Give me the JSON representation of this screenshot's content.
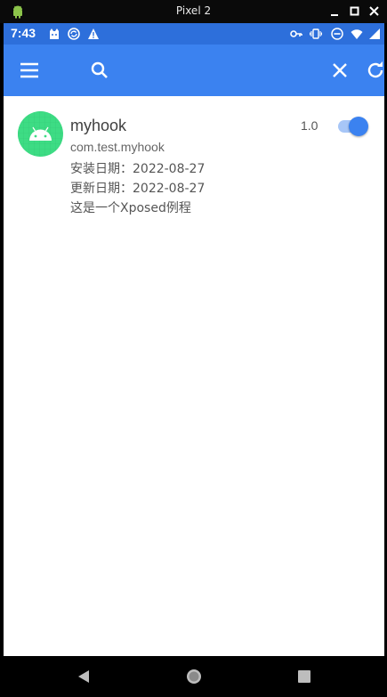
{
  "window": {
    "title": "Pixel 2",
    "icons": [
      "android-emulator-icon",
      "minimize-icon",
      "maximize-icon",
      "close-icon"
    ]
  },
  "statusbar": {
    "time": "7:43",
    "left_icons": [
      "cat-icon",
      "sync-icon",
      "warning-icon"
    ],
    "right_icons": [
      "key-icon",
      "vibrate-icon",
      "do-not-disturb-icon",
      "wifi-icon",
      "signal-icon"
    ]
  },
  "appbar": {
    "icons": [
      "menu-icon",
      "search-icon",
      "clear-icon",
      "refresh-icon"
    ],
    "color": "#3b82f0"
  },
  "modules": [
    {
      "name": "myhook",
      "package": "com.test.myhook",
      "install_date": "安装日期：2022-08-27",
      "update_date": "更新日期：2022-08-27",
      "description": "这是一个Xposed例程",
      "version": "1.0",
      "enabled": true
    }
  ],
  "navbar": {
    "icons": [
      "back-icon",
      "home-icon",
      "recents-icon"
    ]
  },
  "colors": {
    "statusbar": "#2d6fdb",
    "accent": "#3b82f0",
    "app_icon_bg": "#3ddc84"
  }
}
